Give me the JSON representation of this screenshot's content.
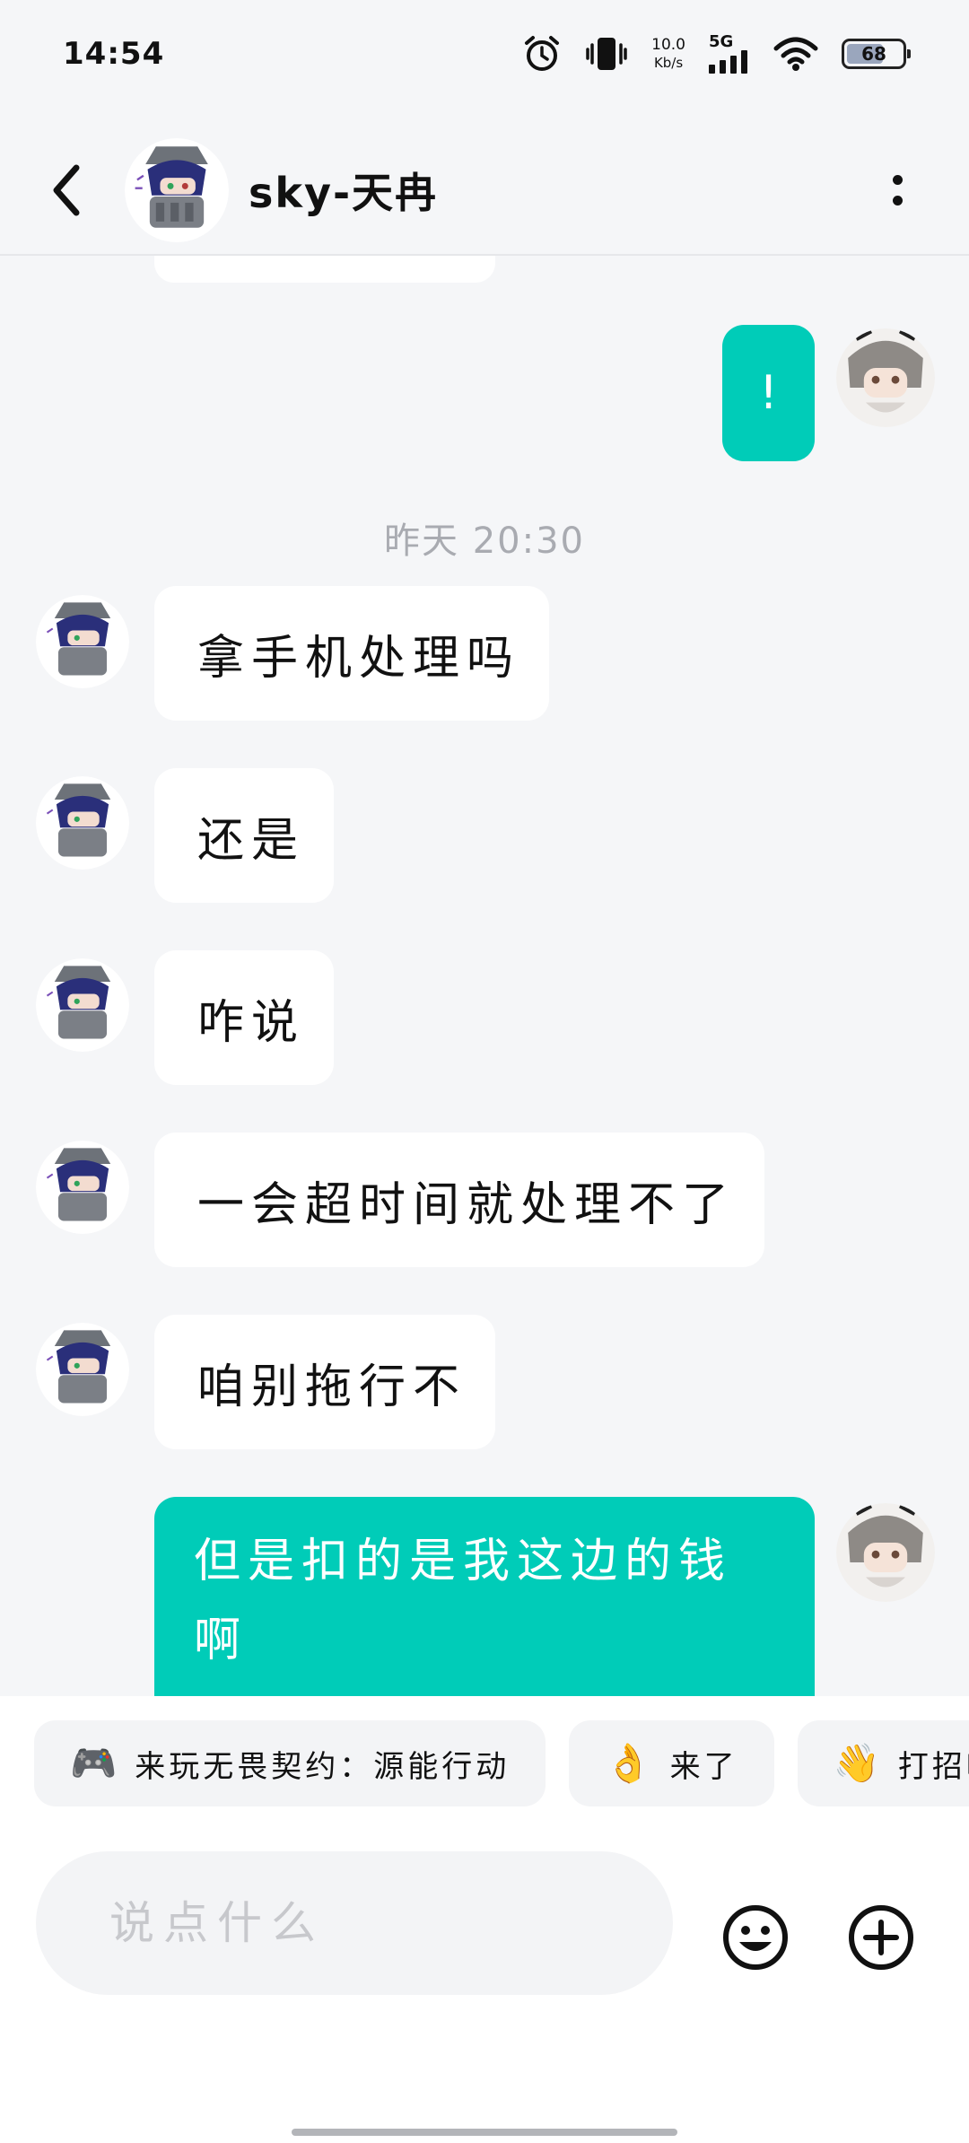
{
  "status_bar": {
    "time": "14:54",
    "net_speed_value": "10.0",
    "net_speed_unit": "Kb/s",
    "network": "5G",
    "battery": "68",
    "icons": [
      "alarm-icon",
      "vibrate-icon",
      "signal-icon",
      "wifi-icon",
      "battery-icon"
    ]
  },
  "header": {
    "contact_name": "sky-天冉",
    "back_icon": "chevron-left-icon",
    "more_icon": "more-vertical-icon"
  },
  "chat": {
    "messages_before": [
      {
        "direction": "out",
        "text": "!"
      }
    ],
    "timestamp": "昨天  20:30",
    "messages": [
      {
        "direction": "in",
        "text": "拿手机处理吗"
      },
      {
        "direction": "in",
        "text": "还是"
      },
      {
        "direction": "in",
        "text": "咋说"
      },
      {
        "direction": "in",
        "text": "一会超时间就处理不了"
      },
      {
        "direction": "in",
        "text": "咱别拖行不"
      },
      {
        "direction": "out",
        "line1": "但是扣的是我这边的钱",
        "line2": "啊"
      }
    ]
  },
  "quick_replies": [
    {
      "emoji": "🎮",
      "label": "来玩无畏契约：源能行动"
    },
    {
      "emoji": "👌",
      "label": "来了"
    },
    {
      "emoji": "👋",
      "label": "打招呼"
    }
  ],
  "composer": {
    "placeholder": "说点什么",
    "emoji_icon": "smile-icon",
    "plus_icon": "plus-circle-icon"
  },
  "colors": {
    "accent": "#00ccb8",
    "background": "#f5f6f8"
  }
}
